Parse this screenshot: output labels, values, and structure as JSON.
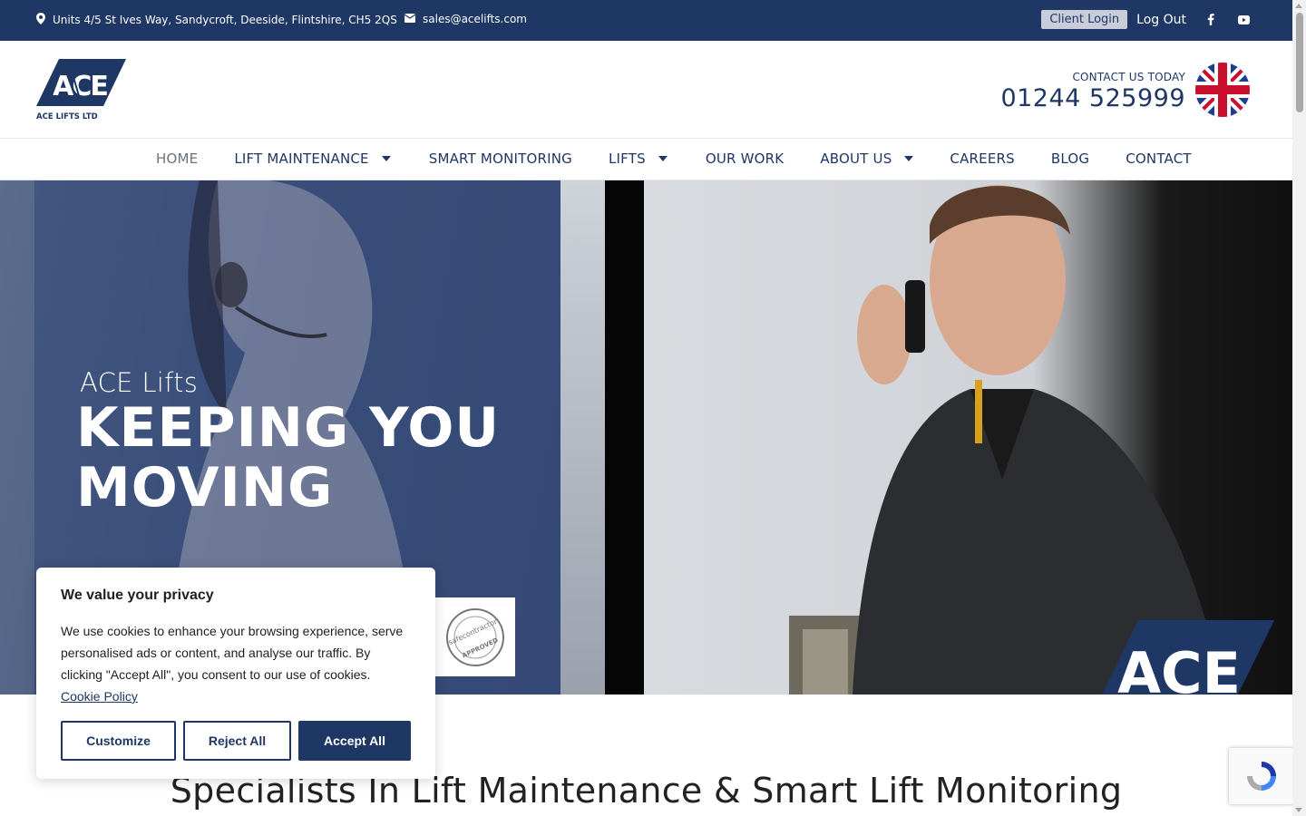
{
  "topbar": {
    "address": "Units 4/5 St Ives Way, Sandycroft, Deeside, Flintshire, CH5 2QS",
    "email": "sales@acelifts.com",
    "client_login": "Client Login",
    "logout": "Log Out",
    "social_icons": [
      "facebook-icon",
      "youtube-icon"
    ]
  },
  "header": {
    "logo_text": "ACE",
    "logo_sub": "ACE LIFTS LTD",
    "contact_label": "CONTACT US TODAY",
    "phone": "01244 525999"
  },
  "nav": {
    "items": [
      {
        "label": "HOME",
        "active": true,
        "dropdown": false
      },
      {
        "label": "LIFT MAINTENANCE",
        "dropdown": true
      },
      {
        "label": "SMART MONITORING",
        "dropdown": false
      },
      {
        "label": "LIFTS",
        "dropdown": true
      },
      {
        "label": "OUR WORK",
        "dropdown": false
      },
      {
        "label": "ABOUT US",
        "dropdown": true
      },
      {
        "label": "CAREERS",
        "dropdown": false
      },
      {
        "label": "BLOG",
        "dropdown": false
      },
      {
        "label": "CONTACT",
        "dropdown": false
      }
    ]
  },
  "hero": {
    "subtitle": "ACE Lifts",
    "title_line1": "KEEPING YOU",
    "title_line2": "MOVING",
    "badge_text": "safecontractor",
    "badge_sub": "APPROVED",
    "corner_logo": "ACE"
  },
  "cookie": {
    "heading": "We value your privacy",
    "body": "We use cookies to enhance your browsing experience, serve personalised ads or content, and analyse our traffic. By clicking \"Accept All\", you consent to our use of cookies.",
    "policy_link": "Cookie Policy",
    "customize": "Customize",
    "reject": "Reject All",
    "accept": "Accept All"
  },
  "section": {
    "title": "Specialists In Lift Maintenance & Smart Lift Monitoring"
  },
  "colors": {
    "brand_navy": "#1e3764",
    "white": "#ffffff"
  }
}
